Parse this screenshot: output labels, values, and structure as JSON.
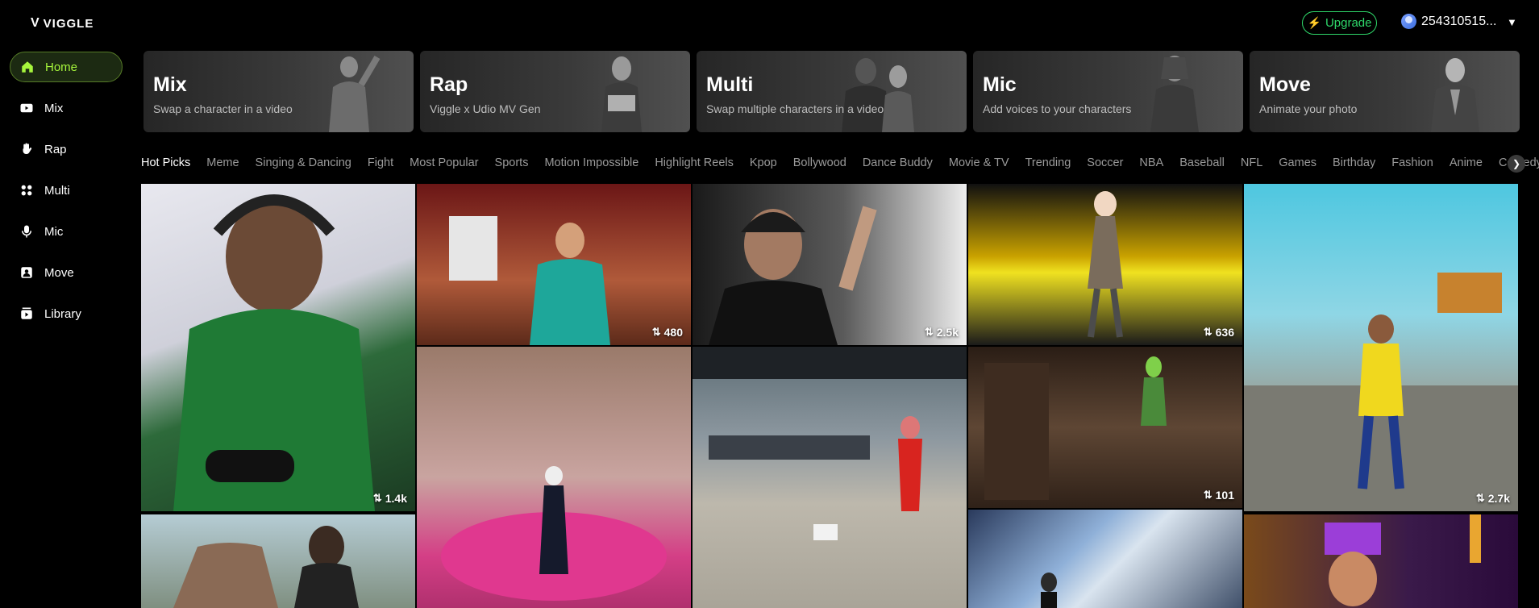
{
  "brand": {
    "name": "VIGGLE",
    "mark": "V"
  },
  "header": {
    "upgrade_label": "Upgrade",
    "username": "254310515...",
    "caret": "▼"
  },
  "sidebar": {
    "items": [
      {
        "label": "Home",
        "icon": "home-icon"
      },
      {
        "label": "Mix",
        "icon": "video-icon"
      },
      {
        "label": "Rap",
        "icon": "hand-icon"
      },
      {
        "label": "Multi",
        "icon": "multi-icon"
      },
      {
        "label": "Mic",
        "icon": "mic-icon"
      },
      {
        "label": "Move",
        "icon": "person-icon"
      },
      {
        "label": "Library",
        "icon": "library-icon"
      }
    ]
  },
  "cards": [
    {
      "title": "Mix",
      "subtitle": "Swap a character in a video"
    },
    {
      "title": "Rap",
      "subtitle": "Viggle x Udio MV Gen"
    },
    {
      "title": "Multi",
      "subtitle": "Swap multiple characters in a video"
    },
    {
      "title": "Mic",
      "subtitle": "Add voices to your characters"
    },
    {
      "title": "Move",
      "subtitle": "Animate your photo"
    }
  ],
  "tabs": [
    "Hot Picks",
    "Meme",
    "Singing & Dancing",
    "Fight",
    "Most Popular",
    "Sports",
    "Motion Impossible",
    "Highlight Reels",
    "Kpop",
    "Bollywood",
    "Dance Buddy",
    "Movie & TV",
    "Trending",
    "Soccer",
    "NBA",
    "Baseball",
    "NFL",
    "Games",
    "Birthday",
    "Fashion",
    "Anime",
    "Comedy"
  ],
  "tiles": [
    {
      "count": "1.4k"
    },
    {
      "count": ""
    },
    {
      "count": "480"
    },
    {
      "count": ""
    },
    {
      "count": "2.5k"
    },
    {
      "count": ""
    },
    {
      "count": "636"
    },
    {
      "count": "101"
    },
    {
      "count": ""
    },
    {
      "count": "2.7k"
    },
    {
      "count": ""
    }
  ]
}
